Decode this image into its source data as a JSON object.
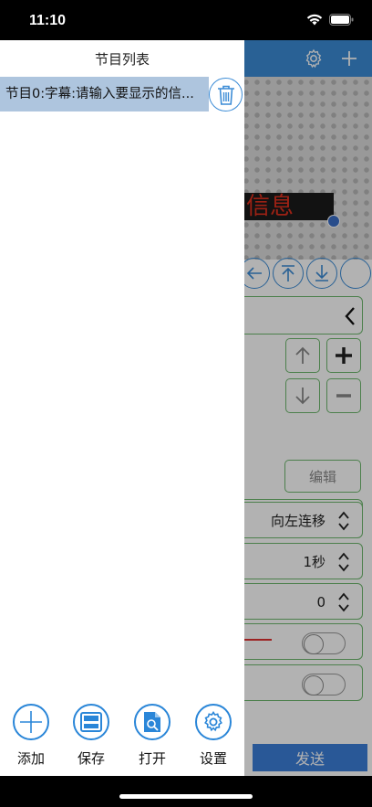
{
  "status_bar": {
    "time": "11:10"
  },
  "drawer": {
    "title": "节目列表",
    "programs": [
      {
        "label": "节目0:字幕:请输入要显示的信..."
      }
    ],
    "tools": [
      {
        "label": "添加",
        "icon": "plus-icon"
      },
      {
        "label": "保存",
        "icon": "save-icon"
      },
      {
        "label": "打开",
        "icon": "open-file-icon"
      },
      {
        "label": "设置",
        "icon": "gear-icon"
      }
    ]
  },
  "editor": {
    "preview_text": "信息",
    "edit_label": "编辑",
    "move_mode": "向左连移",
    "speed": "1秒",
    "stay_value": "0",
    "send_label": "发送"
  },
  "colors": {
    "accent": "#3c8cd6",
    "led_text": "#e0301e",
    "panel_border": "#6db86d"
  }
}
